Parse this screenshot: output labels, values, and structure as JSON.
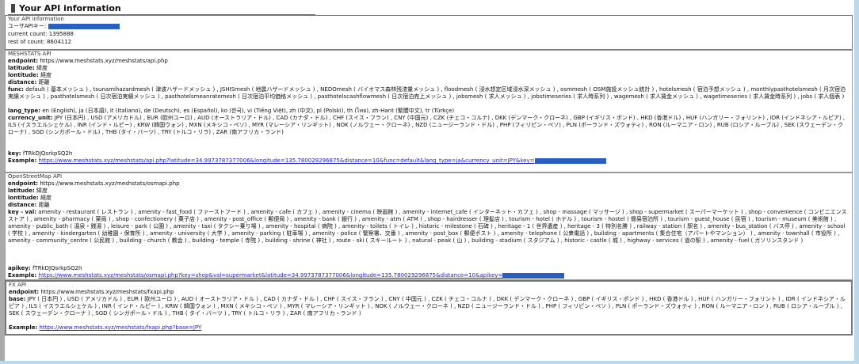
{
  "page": {
    "title": "Your API information"
  },
  "info": {
    "legend": "Your API information",
    "key_label": "ユーザAPIキー:",
    "current_count": "current count: 1395888",
    "rest_of_count": "rest of count: 8604112"
  },
  "mesh": {
    "legend": "MESHSTATS API",
    "endpoint_label": "endpoint:",
    "endpoint": "https://www.meshstats.xyz/meshstats/api.php",
    "latitude_label": "latitude:",
    "latitude": "緯度",
    "lontitude_label": "lontitude:",
    "lontitude": "経度",
    "distance_label": "distance:",
    "distance": "距離",
    "func_label": "func:",
    "func_text": " default ( 基本メッシュ ) , tsunamihazardmesh ( 津波ハザードメッシュ ) , JSHISmesh ( 地震ハザードメッシュ ) , NEDOmesh ( バイオマス森林残渣量メッシュ ) , floodmesh ( 浸水想定区域浸水深メッシュ ) , osmmesh ( OSM施設メッシュ統計 ) , hotelsmesh ( 宿泊予想メッシュ ) , monthlypasthotelsmesh ( 月次宿泊実績メッシュ ) , pasthotelsmesh ( 日次宿泊実績メッシュ ) , pasthotelsmeanratemesh ( 日次宿泊平均価格メッシュ ) , pasthotelscashflowmesh ( 日次宿泊売上メッシュ ) , jobsmesh ( 求人メッシュ ) , jobstimeseries ( 求人時系列 ) , wagemesh ( 求人賃金メッシュ ) , wagetimeseries ( 求人賃金時系列 ) , jobs ( 求人個表 )",
    "lang_label": "lang_type:",
    "lang_text": " en (English), ja (日本語), it (Italiano), de (Deutsch), es (Español), ko (한국), vi (Tiếng Việt), zh (中文), pl (Polski), th (ไทย), zh-Hant (繁體中文), tr (Türkçe)",
    "currency_label": "currency_unit:",
    "currency_text": " JPY (日本円) , USD (アメリカドル) , EUR (欧州ユーロ) , AUD (オーストラリア・ドル) , CAD (カナダ・ドル) , CHF (スイス・フラン) , CNY (中国元) , CZK (チェコ・コルナ) , DKK (デンマーク・クローネ) , GBP (イギリス・ポンド) , HKD (香港ドル) , HUF (ハンガリー・フォリント) , IDR (インドネシア・ルピア) , ILS (イスラエルシェケル) , INR (インド・ルピー) , KRW (韓国ウォン) , MXN (メキシコ・ペソ) , MYR (マレーシア・リンギット) , NOK (ノルウェー・クローネ) , NZD (ニュージーランド・ドル) , PHP (フィリピン・ペソ) , PLN (ポーランド・ズウォティ) , RON (ルーマニア・ロン) , RUB (ロシア・ルーブル) , SEK (スウェーデン・クローナ) , SGD (シンガポール・ドル) , THB (タイ・バーツ) , TRY (トルコ・リラ) , ZAR (南アフリカ・ランド)",
    "key_label": "key:",
    "key": "fTRkDJQsrkpSQ2h",
    "example_label": "Example:",
    "example_url": "https://www.meshstats.xyz/meshstats/api.php?latitude=34.9973787377006&longitude=135.780029296875&distance=10&func=default&lang_type=ja&currency_unit=JPY&key="
  },
  "osm": {
    "legend": "OpenStreetMap API",
    "endpoint_label": "endpoint:",
    "endpoint": "https://www.meshstats.xyz/meshstats/osmapi.php",
    "latitude_label": "latitude:",
    "latitude": "緯度",
    "lontitude_label": "lontitude:",
    "lontitude": "経度",
    "distance_label": "distance:",
    "distance": "距離",
    "keyval_label": "key - val:",
    "keyval_text": " amenity - restaurant ( レストラン ) , amenity - fast_food ( ファーストフード ) , amenity - cafe ( カフェ ) , amenity - cinema ( 映画館 ) , amenity - internet_cafe ( インターネット・カフェ ) , shop - massage ( マッサージ ) , shop - supermarket ( スーパーマーケット ) , shop - convenience ( コンビニエンスストア ) , amenity - pharmacy ( 薬局 ) , shop - confectionery ( 菓子店 ) , amenity - post_office ( 郵便局 ) , amenity - bank ( 銀行 ) , amenity - atm ( ATM ) , shop - hairdresser ( 理髪店 ) , tourism - hotel ( ホテル ) , tourism - hostel ( 簡易宿泊所 ) , tourism - guest_house ( 民宿 ) , tourism - museum ( 美術館 ) , amenity - public_bath ( 温泉・銭湯 ) , leisure - park ( 公園 ) , amenity - taxi ( タクシー乗り場 ) , amenity - hospital ( 病院 ) , amenity - toilets ( トイレ ) , historic - milestone ( 石碑 ) , heritage - 1 ( 世界遺産 ) , heritage - 3 ( 特別名勝 ) , railway - station ( 駅名 ) , amenity - bus_station ( バス停 ) , amenity - school ( 学校 ) , amenity - kindergarten ( 幼稚園・保育所 ) , amenity - university ( 大学 ) , amenity - parking ( 駐車場 ) , amenity - police ( 警察署、交番 ) , amenity - post_box ( 郵便ポスト ) , amenity - telephone ( 公衆電話 ) , building - apartments ( 集合住宅（アパートやマンション） ) , amenity - townhall ( 市役所 ) , amenity - community_centre ( 公民館 ) , building - church ( 教会 ) , building - temple ( 寺院 ) , building - shrine ( 神社 ) , route - ski ( スキールート ) , natural - peak ( 山 ) , building - stadium ( スタジアム ) , historic - castle ( 城 ) , highway - services ( 道の駅 ) , amenity - fuel ( ガソリンスタンド )",
    "apikey_label": "apikey:",
    "apikey": "fTRkDJQsrkpSQ2h",
    "example_label": "Example:",
    "example_url": "https://www.meshstats.xyz/meshstats/osmapi.php?key=shop&val=supermarket&latitude=34.9973787377006&longitude=135.780029296875&distance=10&apikey="
  },
  "fx": {
    "legend": "FX API",
    "endpoint_label": "endpoint:",
    "endpoint": "https://www.meshstats.xyz/meshstats/fxapi.php",
    "base_label": "base:",
    "base_text": " JPY ( 日本円 ) , USD ( アメリカドル ) , EUR ( 欧州ユーロ ) , AUD ( オーストラリア・ドル ) , CAD ( カナダ・ドル ) , CHF ( スイス・フラン ) , CNY ( 中国元 ) , CZK ( チェコ・コルナ ) , DKK ( デンマーク・クローネ ) , GBP ( イギリス・ポンド ) , HKD ( 香港ドル ) , HUF ( ハンガリー・フォリント ) , IDR ( インドネシア・ルピア ) , ILS ( イスラエルシェケル ) , INR ( インド・ルピー ) , KRW ( 韓国ウォン ) , MXN ( メキシコ・ペソ ) , MYR ( マレーシア・リンギット ) , NOK ( ノルウェー・クローネ ) , NZD ( ニュージーランド・ドル ) , PHP ( フィリピン・ペソ ) , PLN ( ポーランド・ズウォティ ) , RON ( ルーマニア・ロン ) , RUB ( ロシア・ルーブル ) , SEK ( スウェーデン・クローナ ) , SGD ( シンガポール・ドル ) , THB ( タイ・バーツ ) , TRY ( トルコ・リラ ) , ZAR ( 南アフリカ・ランド )",
    "example_label": "Example:",
    "example_url": "https://www.meshstats.xyz/meshstats/fxapi.php?base=JPY"
  },
  "colors": {
    "redaction": "#2a5fc2",
    "link": "#2222cc",
    "frame": "#b9d9ec"
  }
}
